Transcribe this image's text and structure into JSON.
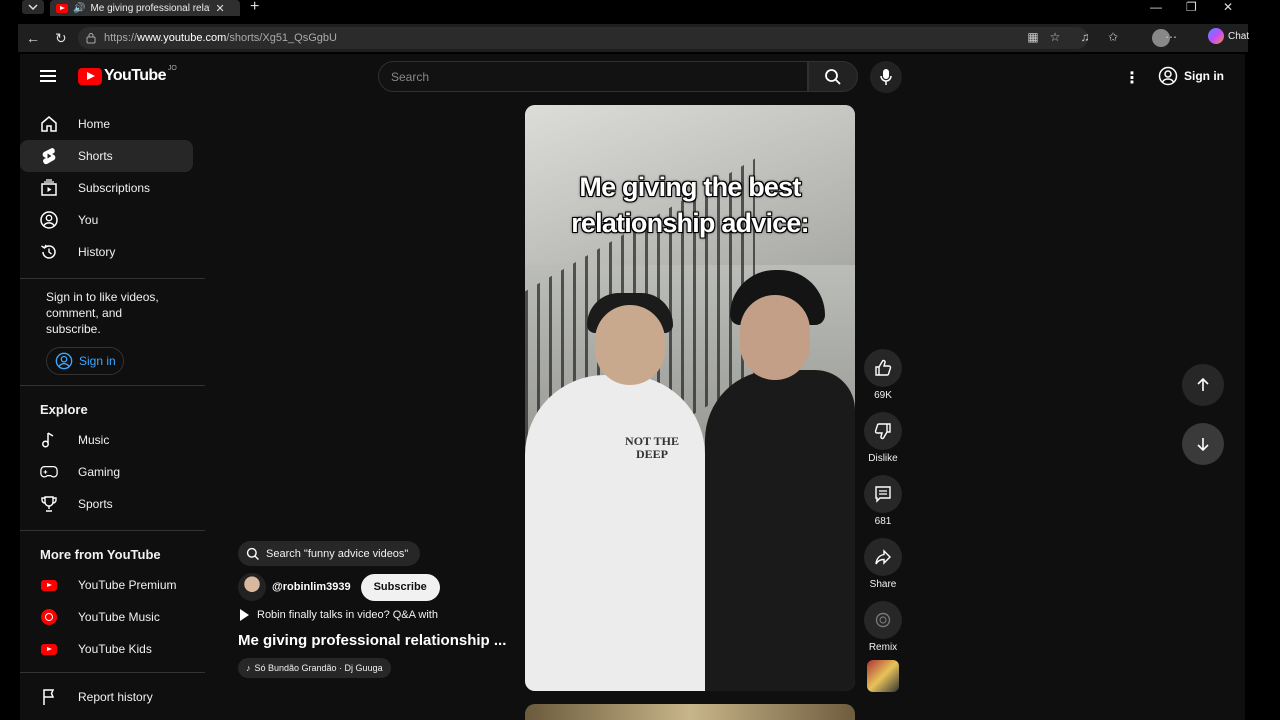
{
  "browser": {
    "tab_title": "Me giving professional relatio",
    "url_prefix": "https://",
    "url_host": "www.youtube.com",
    "url_path": "/shorts/Xg51_QsGgbU",
    "chat_label": "Chat"
  },
  "masthead": {
    "logo_word": "YouTube",
    "country_code": "JO",
    "search_placeholder": "Search",
    "sign_in_label": "Sign in"
  },
  "sidebar": {
    "main": [
      {
        "label": "Home",
        "icon": "home-icon"
      },
      {
        "label": "Shorts",
        "icon": "shorts-icon"
      },
      {
        "label": "Subscriptions",
        "icon": "subscriptions-icon"
      },
      {
        "label": "You",
        "icon": "you-icon"
      },
      {
        "label": "History",
        "icon": "history-icon"
      }
    ],
    "signin_note": "Sign in to like videos, comment, and subscribe.",
    "signin_button": "Sign in",
    "explore_heading": "Explore",
    "explore": [
      {
        "label": "Music",
        "icon": "music-icon"
      },
      {
        "label": "Gaming",
        "icon": "gaming-icon"
      },
      {
        "label": "Sports",
        "icon": "sports-icon"
      }
    ],
    "more_heading": "More from YouTube",
    "more": [
      {
        "label": "YouTube Premium"
      },
      {
        "label": "YouTube Music"
      },
      {
        "label": "YouTube Kids"
      }
    ],
    "report_history": "Report history"
  },
  "short": {
    "caption_line1": "Me giving the best",
    "caption_line2": "relationship advice:",
    "shirt_text": "NOT THE DEEP",
    "search_suggestion": "Search \"funny advice videos\"",
    "channel": "@robinlim3939",
    "subscribe_label": "Subscribe",
    "related_video": "Robin finally talks in video? Q&A with",
    "title": "Me giving professional relationship ...",
    "sound": "Só Bundão Grandão · Dj Guuga"
  },
  "actions": {
    "like_count": "69K",
    "dislike_label": "Dislike",
    "comment_count": "681",
    "share_label": "Share",
    "remix_label": "Remix"
  },
  "colors": {
    "background": "#0f0f0f",
    "accent_red": "#ff0000",
    "link_blue": "#3ea6ff",
    "chip": "#272727"
  }
}
